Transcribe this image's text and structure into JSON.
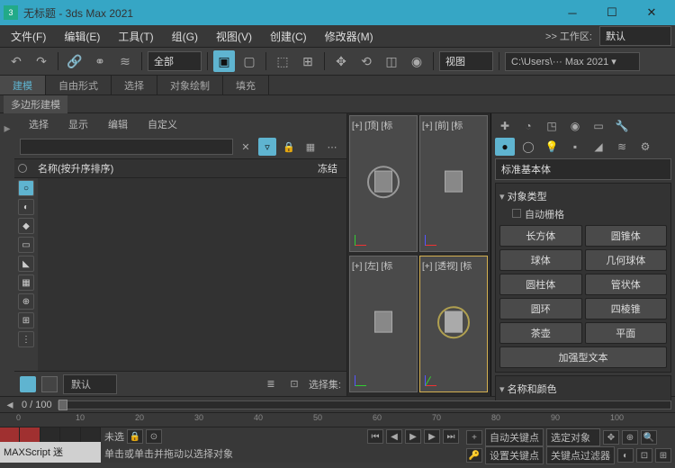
{
  "title": "无标题 - 3ds Max 2021",
  "menus": [
    "文件(F)",
    "编辑(E)",
    "工具(T)",
    "组(G)",
    "视图(V)",
    "创建(C)",
    "修改器(M)"
  ],
  "workspace": {
    "label": ">> 工作区:",
    "value": "默认"
  },
  "toolbar": {
    "all": "全部",
    "viewlabel": "视图",
    "path": "C:\\Users\\··· Max 2021 ▾"
  },
  "ribbon": [
    "建模",
    "自由形式",
    "选择",
    "对象绘制",
    "填充"
  ],
  "ribext": "多边形建模",
  "scene": {
    "tabs": [
      "选择",
      "显示",
      "编辑",
      "自定义"
    ],
    "header": {
      "name": "名称(按升序排序)",
      "freeze": "冻结"
    },
    "footer": {
      "default": "默认",
      "sellabel": "选择集:"
    }
  },
  "viewports": [
    "[+] [顶] [标",
    "[+] [前] [标",
    "[+] [左] [标",
    "[+] [透视] [标"
  ],
  "cmd": {
    "category": "标准基本体",
    "sec1": "对象类型",
    "autogrid": "自动栅格",
    "prims": [
      "长方体",
      "圆锥体",
      "球体",
      "几何球体",
      "圆柱体",
      "管状体",
      "圆环",
      "四棱锥",
      "茶壶",
      "平面"
    ],
    "extra": "加强型文本",
    "sec2": "名称和颜色"
  },
  "time": {
    "range": "0 / 100"
  },
  "ticks": [
    "0",
    "10",
    "20",
    "30",
    "40",
    "50",
    "60",
    "70",
    "80",
    "90",
    "100"
  ],
  "status": {
    "undef": "未选",
    "hint": "单击或单击并拖动以选择对象",
    "maxscript": "MAXScript 迷",
    "autokey": "自动关键点",
    "selobj": "选定对象",
    "setkey": "设置关键点",
    "keyfilter": "关键点过滤器"
  }
}
